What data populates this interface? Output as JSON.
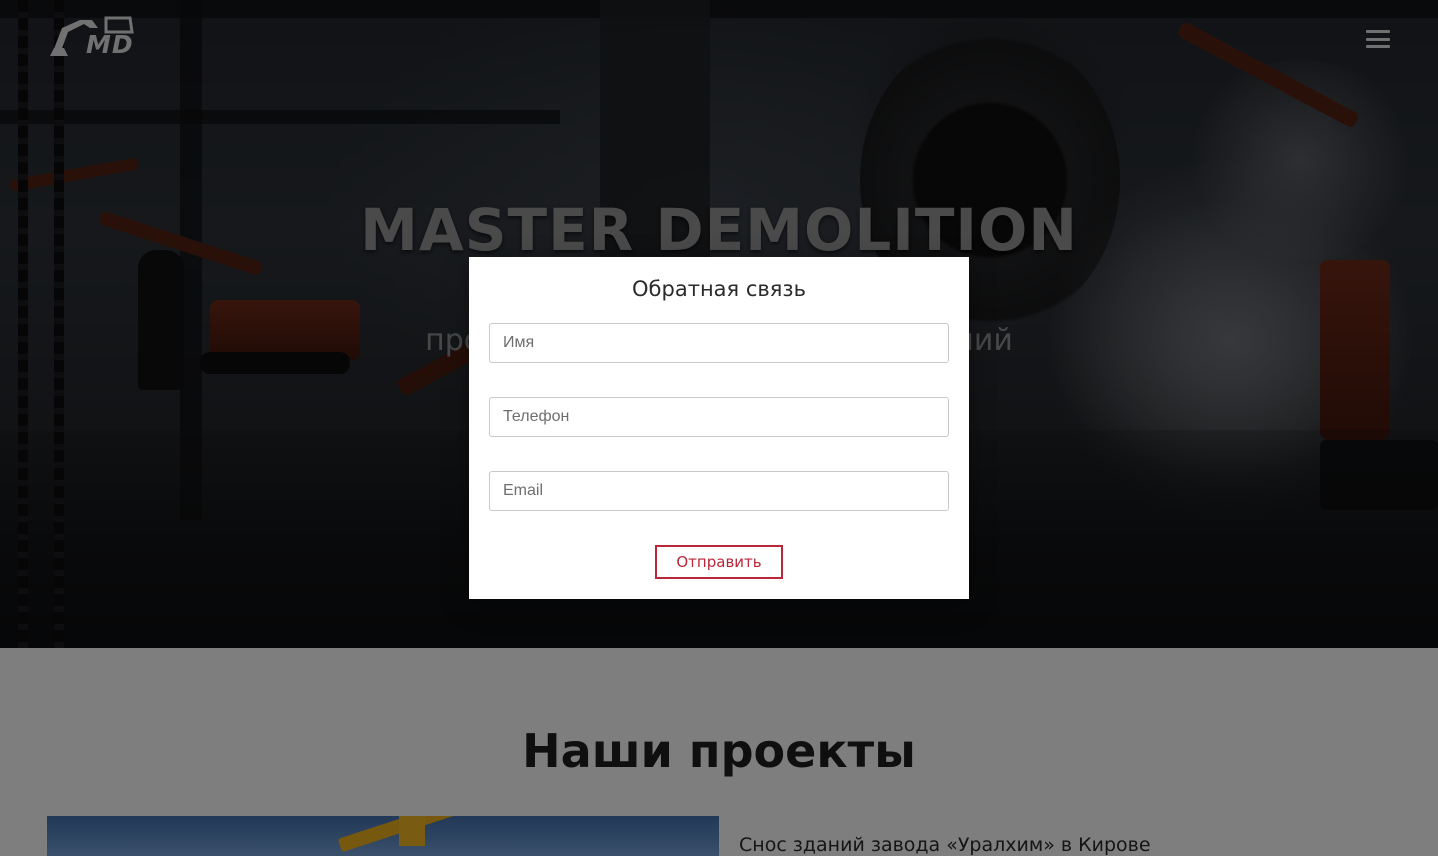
{
  "header": {
    "logo_text": "MD",
    "menu_icon": "hamburger-menu-icon"
  },
  "hero": {
    "title": "MASTER DEMOLITION",
    "subtitle_line1": "Пр                                        жу",
    "subtitle_line2": "промыш                                    зданий",
    "note": "1                                        ."
  },
  "modal": {
    "title": "Обратная связь",
    "fields": [
      {
        "placeholder": "Имя"
      },
      {
        "placeholder": "Телефон"
      },
      {
        "placeholder": "Email"
      }
    ],
    "submit_label": "Отправить"
  },
  "projects": {
    "title": "Наши проекты",
    "items": [
      {
        "name": "Снос зданий завода «Уралхим» в Кирове"
      }
    ]
  },
  "colors": {
    "accent": "#b8283a",
    "overlay": "rgba(0,0,0,0.48)"
  }
}
